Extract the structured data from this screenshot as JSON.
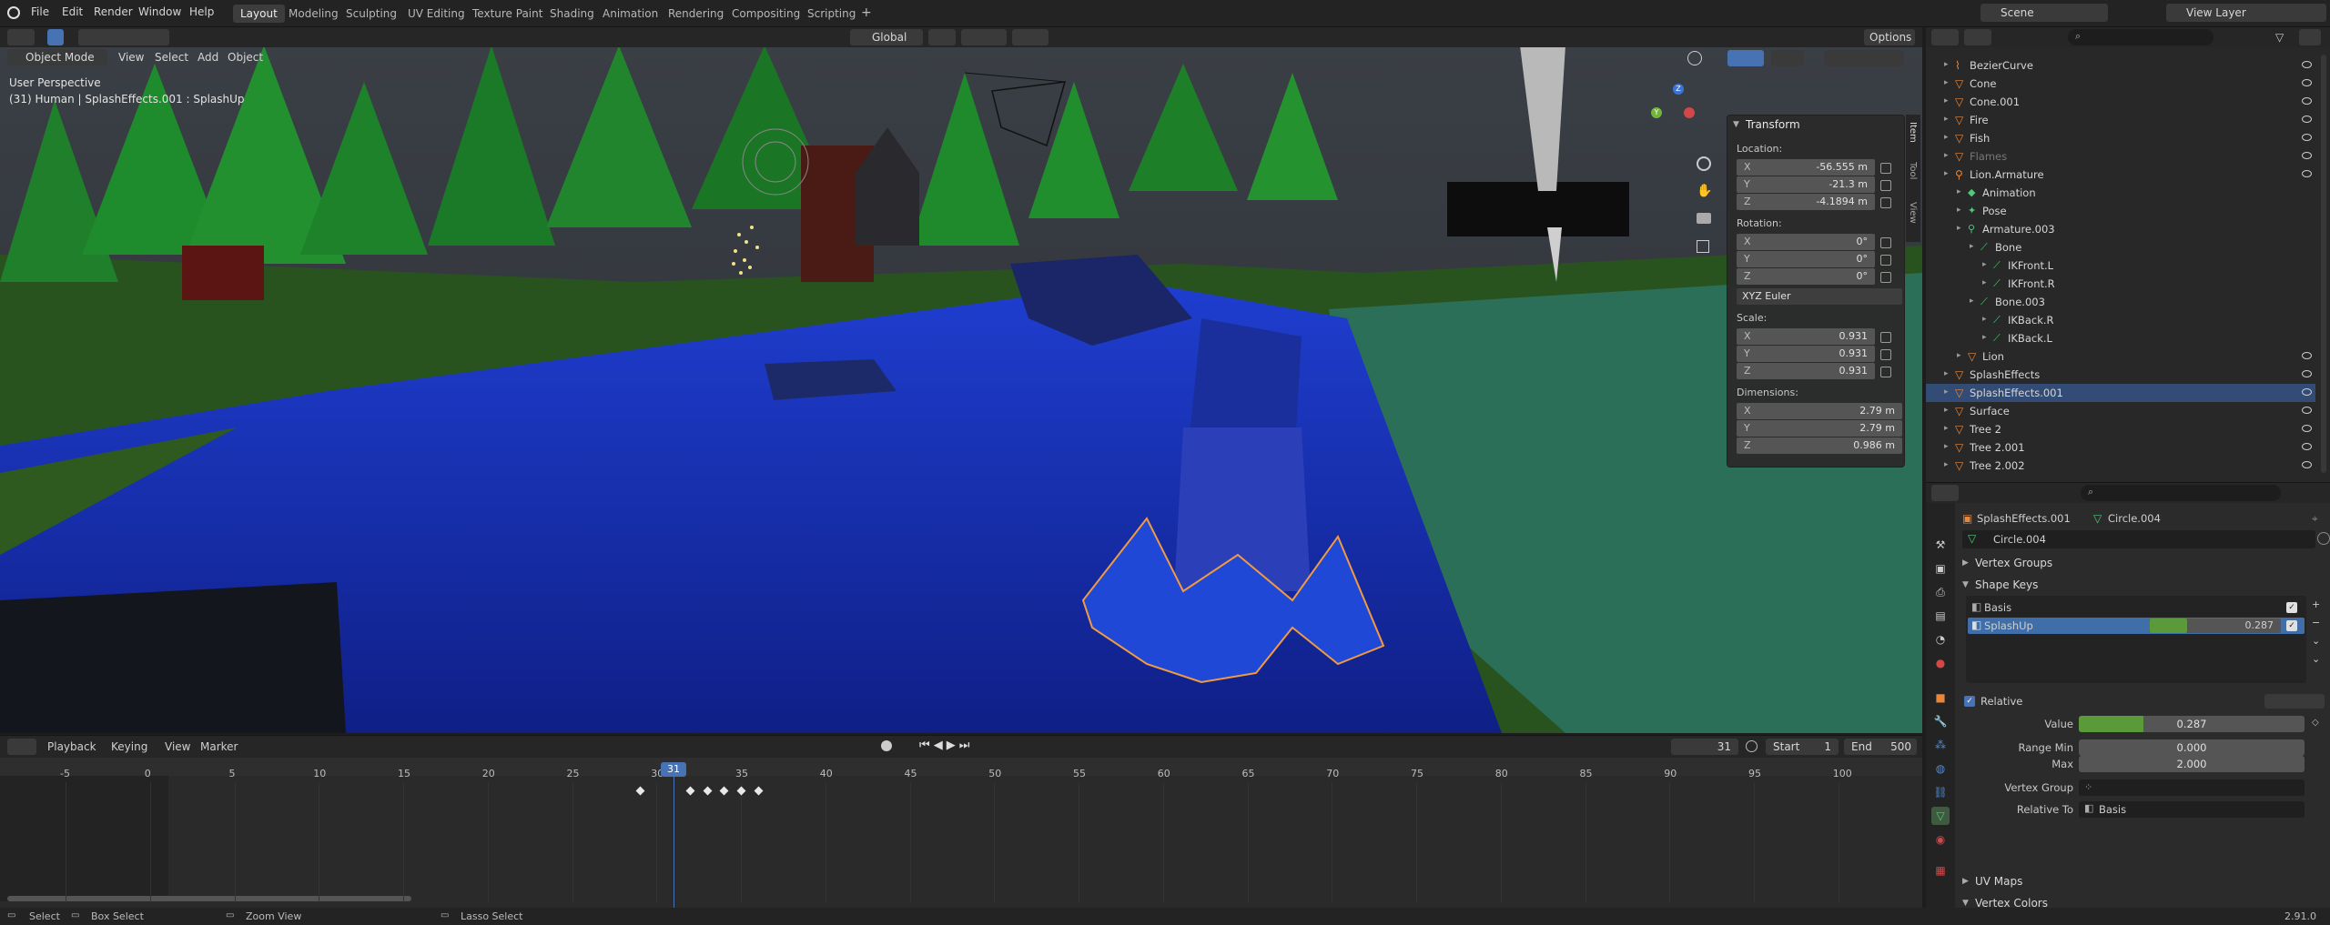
{
  "menubar": {
    "items": [
      "File",
      "Edit",
      "Render",
      "Window",
      "Help"
    ]
  },
  "workspaces": [
    "Layout",
    "Modeling",
    "Sculpting",
    "UV Editing",
    "Texture Paint",
    "Shading",
    "Animation",
    "Rendering",
    "Compositing",
    "Scripting"
  ],
  "scene": {
    "label": "Scene",
    "view_layer": "View Layer"
  },
  "toolbar": {
    "orientation": "Global",
    "options": "Options"
  },
  "viewport_header": {
    "mode": "Object Mode",
    "menus": [
      "View",
      "Select",
      "Add",
      "Object"
    ]
  },
  "viewport": {
    "perspective": "User Perspective",
    "info": "(31) Human | SplashEffects.001 : SplashUp"
  },
  "npanel": {
    "title": "Transform",
    "tabs": [
      "Item",
      "Tool",
      "View"
    ],
    "location_label": "Location:",
    "rotation_label": "Rotation:",
    "scale_label": "Scale:",
    "dimensions_label": "Dimensions:",
    "location": [
      {
        "axis": "X",
        "value": "-56.555 m"
      },
      {
        "axis": "Y",
        "value": "-21.3 m"
      },
      {
        "axis": "Z",
        "value": "-4.1894 m"
      }
    ],
    "rotation": [
      {
        "axis": "X",
        "value": "0°"
      },
      {
        "axis": "Y",
        "value": "0°"
      },
      {
        "axis": "Z",
        "value": "0°"
      }
    ],
    "rotation_mode": "XYZ Euler",
    "scale": [
      {
        "axis": "X",
        "value": "0.931"
      },
      {
        "axis": "Y",
        "value": "0.931"
      },
      {
        "axis": "Z",
        "value": "0.931"
      }
    ],
    "dimensions": [
      {
        "axis": "X",
        "value": "2.79 m"
      },
      {
        "axis": "Y",
        "value": "2.79 m"
      },
      {
        "axis": "Z",
        "value": "0.986 m"
      }
    ]
  },
  "timeline": {
    "menus": [
      "Playback",
      "Keying",
      "View",
      "Marker"
    ],
    "current_frame": "31",
    "start_label": "Start",
    "start": "1",
    "end_label": "End",
    "end": "500",
    "ticks": [
      "-5",
      "0",
      "5",
      "10",
      "15",
      "20",
      "25",
      "30",
      "35",
      "40",
      "45",
      "50",
      "55",
      "60",
      "65",
      "70",
      "75",
      "80",
      "85",
      "90",
      "95",
      "100"
    ]
  },
  "outliner": {
    "rows": [
      {
        "name": "BezierCurve",
        "indent": 1,
        "type": "curve"
      },
      {
        "name": "Cone",
        "indent": 1,
        "type": "mesh"
      },
      {
        "name": "Cone.001",
        "indent": 1,
        "type": "mesh"
      },
      {
        "name": "Fire",
        "indent": 1,
        "type": "mesh"
      },
      {
        "name": "Fish",
        "indent": 1,
        "type": "mesh"
      },
      {
        "name": "Flames",
        "indent": 1,
        "type": "mesh",
        "dim": true
      },
      {
        "name": "Lion.Armature",
        "indent": 1,
        "type": "armature"
      },
      {
        "name": "Animation",
        "indent": 2,
        "type": "anim"
      },
      {
        "name": "Pose",
        "indent": 2,
        "type": "pose"
      },
      {
        "name": "Armature.003",
        "indent": 2,
        "type": "armature-data"
      },
      {
        "name": "Bone",
        "indent": 3,
        "type": "bone"
      },
      {
        "name": "IKFront.L",
        "indent": 4,
        "type": "bone"
      },
      {
        "name": "IKFront.R",
        "indent": 4,
        "type": "bone"
      },
      {
        "name": "Bone.003",
        "indent": 3,
        "type": "bone"
      },
      {
        "name": "IKBack.R",
        "indent": 4,
        "type": "bone"
      },
      {
        "name": "IKBack.L",
        "indent": 4,
        "type": "bone"
      },
      {
        "name": "Lion",
        "indent": 2,
        "type": "mesh"
      },
      {
        "name": "SplashEffects",
        "indent": 1,
        "type": "mesh"
      },
      {
        "name": "SplashEffects.001",
        "indent": 1,
        "type": "mesh",
        "selected": true
      },
      {
        "name": "Surface",
        "indent": 1,
        "type": "mesh"
      },
      {
        "name": "Tree 2",
        "indent": 1,
        "type": "mesh"
      },
      {
        "name": "Tree 2.001",
        "indent": 1,
        "type": "mesh"
      },
      {
        "name": "Tree 2.002",
        "indent": 1,
        "type": "mesh"
      }
    ]
  },
  "properties": {
    "object": "SplashEffects.001",
    "mesh": "Circle.004",
    "data_name": "Circle.004",
    "vertex_groups": "Vertex Groups",
    "shape_keys": "Shape Keys",
    "keys": [
      {
        "name": "Basis",
        "value": ""
      },
      {
        "name": "SplashUp",
        "value": "0.287"
      }
    ],
    "relative": "Relative",
    "value_label": "Value",
    "value": "0.287",
    "value_fraction": 0.287,
    "range_min_label": "Range Min",
    "range_min": "0.000",
    "max_label": "Max",
    "max": "2.000",
    "vertex_group_label": "Vertex Group",
    "vertex_group": "",
    "relative_to_label": "Relative To",
    "relative_to": "Basis",
    "uv_maps": "UV Maps",
    "vertex_colors": "Vertex Colors"
  },
  "statusbar": {
    "select": "Select",
    "box_select": "Box Select",
    "zoom_view": "Zoom View",
    "lasso_select": "Lasso Select",
    "version": "2.91.0"
  },
  "colors": {
    "accent": "#4772b3",
    "selected_row": "#334c75",
    "keyframe": "#e8e8e8",
    "value_bar": "#5a9a3a",
    "object_orange": "#e8873a"
  }
}
